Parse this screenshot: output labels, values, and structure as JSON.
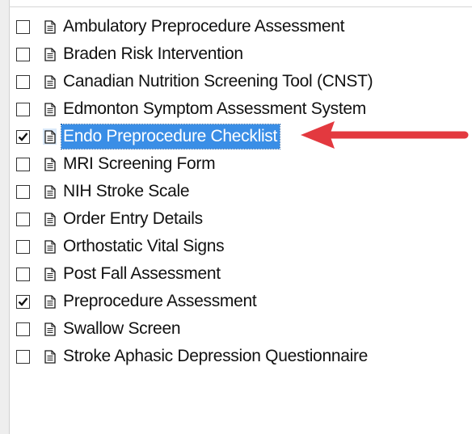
{
  "form_list": {
    "items": [
      {
        "label": "Ambulatory Preprocedure Assessment",
        "checked": false,
        "selected": false
      },
      {
        "label": "Braden Risk Intervention",
        "checked": false,
        "selected": false
      },
      {
        "label": "Canadian Nutrition Screening Tool (CNST)",
        "checked": false,
        "selected": false
      },
      {
        "label": "Edmonton Symptom Assessment System",
        "checked": false,
        "selected": false
      },
      {
        "label": "Endo Preprocedure Checklist",
        "checked": true,
        "selected": true
      },
      {
        "label": "MRI Screening Form",
        "checked": false,
        "selected": false
      },
      {
        "label": "NIH Stroke Scale",
        "checked": false,
        "selected": false
      },
      {
        "label": "Order Entry Details",
        "checked": false,
        "selected": false
      },
      {
        "label": "Orthostatic Vital Signs",
        "checked": false,
        "selected": false
      },
      {
        "label": "Post Fall Assessment",
        "checked": false,
        "selected": false
      },
      {
        "label": "Preprocedure Assessment",
        "checked": true,
        "selected": false
      },
      {
        "label": "Swallow Screen",
        "checked": false,
        "selected": false
      },
      {
        "label": "Stroke Aphasic Depression Questionnaire",
        "checked": false,
        "selected": false
      }
    ]
  },
  "icons": {
    "item_icon": "document-icon",
    "check_mark": "check-icon",
    "annotation": "red-arrow-icon"
  },
  "colors": {
    "selection_bg": "#3a8ee6",
    "selection_text": "#ffffff",
    "arrow": "#e3393f"
  }
}
